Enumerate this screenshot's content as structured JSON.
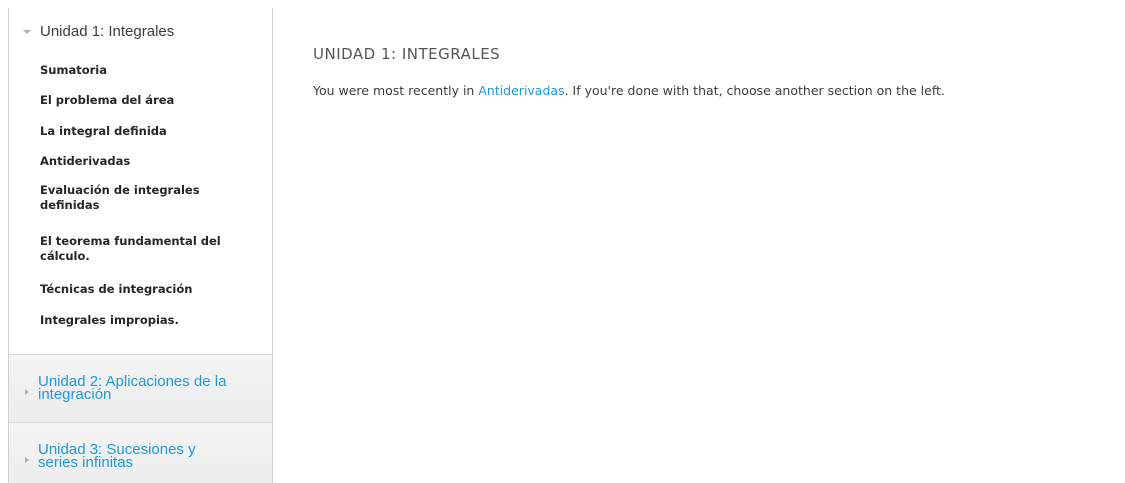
{
  "sidebar": {
    "open_chapter": {
      "title": "Unidad 1: Integrales",
      "sections": [
        {
          "label": "Sumatoria"
        },
        {
          "label": "El problema del área"
        },
        {
          "label": "La integral definida"
        },
        {
          "label": "Antiderivadas"
        },
        {
          "label": "Evaluación de integrales definidas"
        },
        {
          "label": "El teorema fundamental del cálculo."
        },
        {
          "label": "Técnicas de integración"
        },
        {
          "label": "Integrales impropias."
        }
      ]
    },
    "closed_chapters": [
      {
        "title": "Unidad 2: Aplicaciones de la integración"
      },
      {
        "title": "Unidad 3: Sucesiones y series infinitas"
      }
    ]
  },
  "main": {
    "title": "UNIDAD 1: INTEGRALES",
    "message_prefix": "You were most recently in ",
    "message_link": "Antiderivadas",
    "message_suffix": ". If you're done with that, choose another section on the left."
  },
  "colors": {
    "link": "#1d9ad9",
    "text": "#3c3c3c",
    "border": "#d0d0d0"
  },
  "icons": {
    "expanded": "triangle-down-icon",
    "collapsed": "triangle-right-icon"
  }
}
